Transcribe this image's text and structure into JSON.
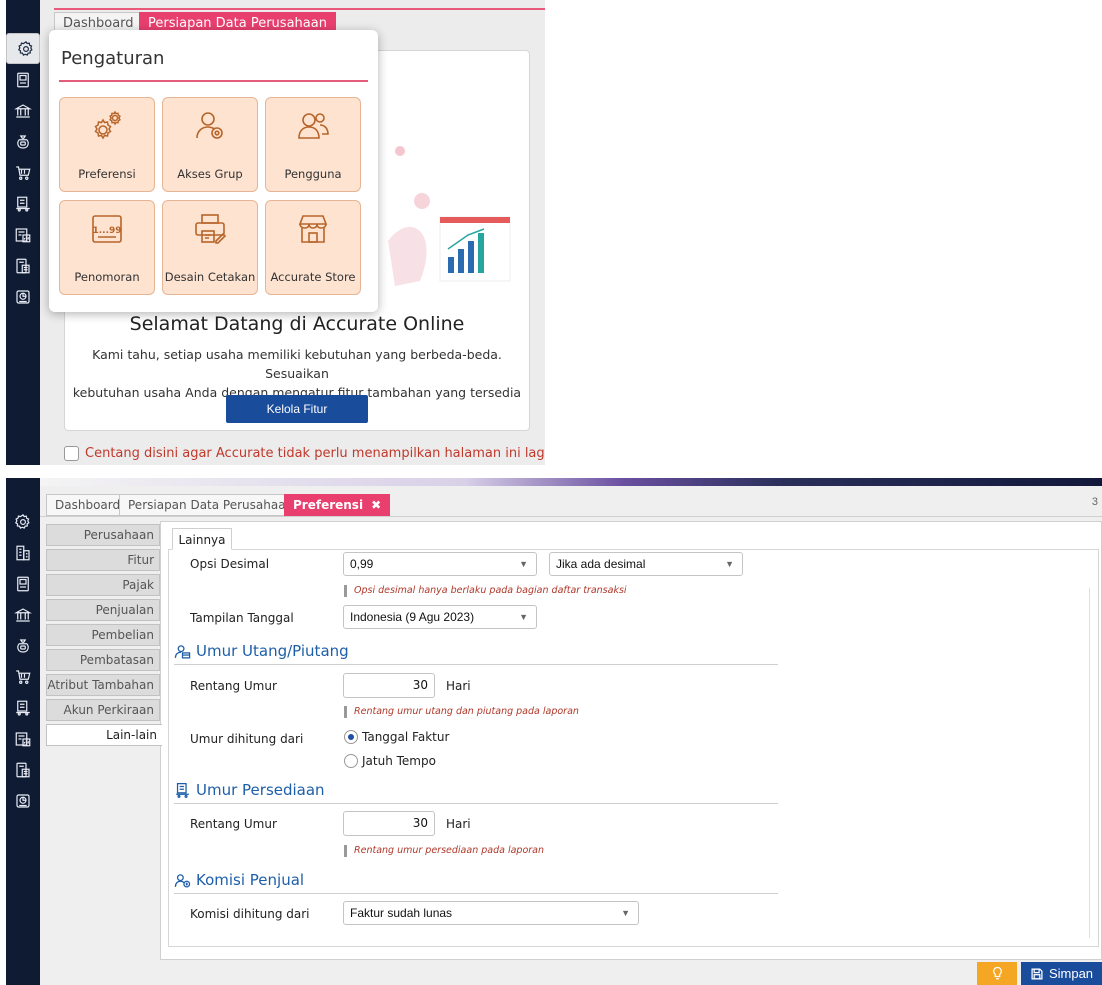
{
  "top": {
    "tabs": [
      "Dashboard",
      "Persiapan Data Perusahaan"
    ],
    "popup_title": "Pengaturan",
    "tiles": [
      {
        "label": "Preferensi",
        "icon": "gears-icon"
      },
      {
        "label": "Akses Grup",
        "icon": "user-group-icon"
      },
      {
        "label": "Pengguna",
        "icon": "users-icon"
      },
      {
        "label": "Penomoran",
        "icon": "numbering-icon"
      },
      {
        "label": "Desain Cetakan",
        "icon": "printer-design-icon"
      },
      {
        "label": "Accurate Store",
        "icon": "store-icon"
      }
    ],
    "welcome": "Selamat Datang di Accurate Online",
    "desc_line1": "Kami tahu, setiap usaha memiliki kebutuhan yang berbeda-beda. Sesuaikan",
    "desc_line2": "kebutuhan usaha Anda dengan mengatur fitur tambahan yang tersedia disini",
    "kelola_button": "Kelola Fitur",
    "checkbox_label": "Centang disini agar Accurate tidak perlu menampilkan halaman ini lagi"
  },
  "bottom": {
    "tabs": [
      "Dashboard",
      "Persiapan Data Perusahaan",
      "Preferensi"
    ],
    "close_glyph": "✖",
    "tab_count": "3",
    "side_items": [
      "Perusahaan",
      "Fitur",
      "Pajak",
      "Penjualan",
      "Pembelian",
      "Pembatasan",
      "Atribut Tambahan",
      "Akun Perkiraan",
      "Lain-lain"
    ],
    "inner_tab": "Lainnya",
    "opsi_desimal": {
      "label": "Opsi Desimal",
      "value": "0,99",
      "value2": "Jika ada desimal",
      "hint": "Opsi desimal hanya berlaku pada bagian daftar transaksi"
    },
    "tampilan_tanggal": {
      "label": "Tampilan Tanggal",
      "value": "Indonesia (9 Agu 2023)"
    },
    "umur_utang": {
      "title": "Umur Utang/Piutang",
      "rentang_label": "Rentang Umur",
      "rentang_value": "30",
      "unit": "Hari",
      "hint": "Rentang umur utang dan piutang pada laporan",
      "dihitung_label": "Umur dihitung dari",
      "options": [
        "Tanggal Faktur",
        "Jatuh Tempo"
      ],
      "selected": "Tanggal Faktur"
    },
    "umur_persediaan": {
      "title": "Umur Persediaan",
      "rentang_label": "Rentang Umur",
      "rentang_value": "30",
      "unit": "Hari",
      "hint": "Rentang umur persediaan pada laporan"
    },
    "komisi": {
      "title": "Komisi Penjual",
      "label": "Komisi dihitung dari",
      "value": "Faktur sudah lunas"
    },
    "save_button": "Simpan"
  },
  "colors": {
    "sidebar": "#0f1a33",
    "accent_pink": "#e83f6f",
    "primary_blue": "#1a4c9c",
    "tile_bg": "#fde3d0",
    "hint_red": "#b0392b",
    "section_blue": "#1d5ea8"
  }
}
